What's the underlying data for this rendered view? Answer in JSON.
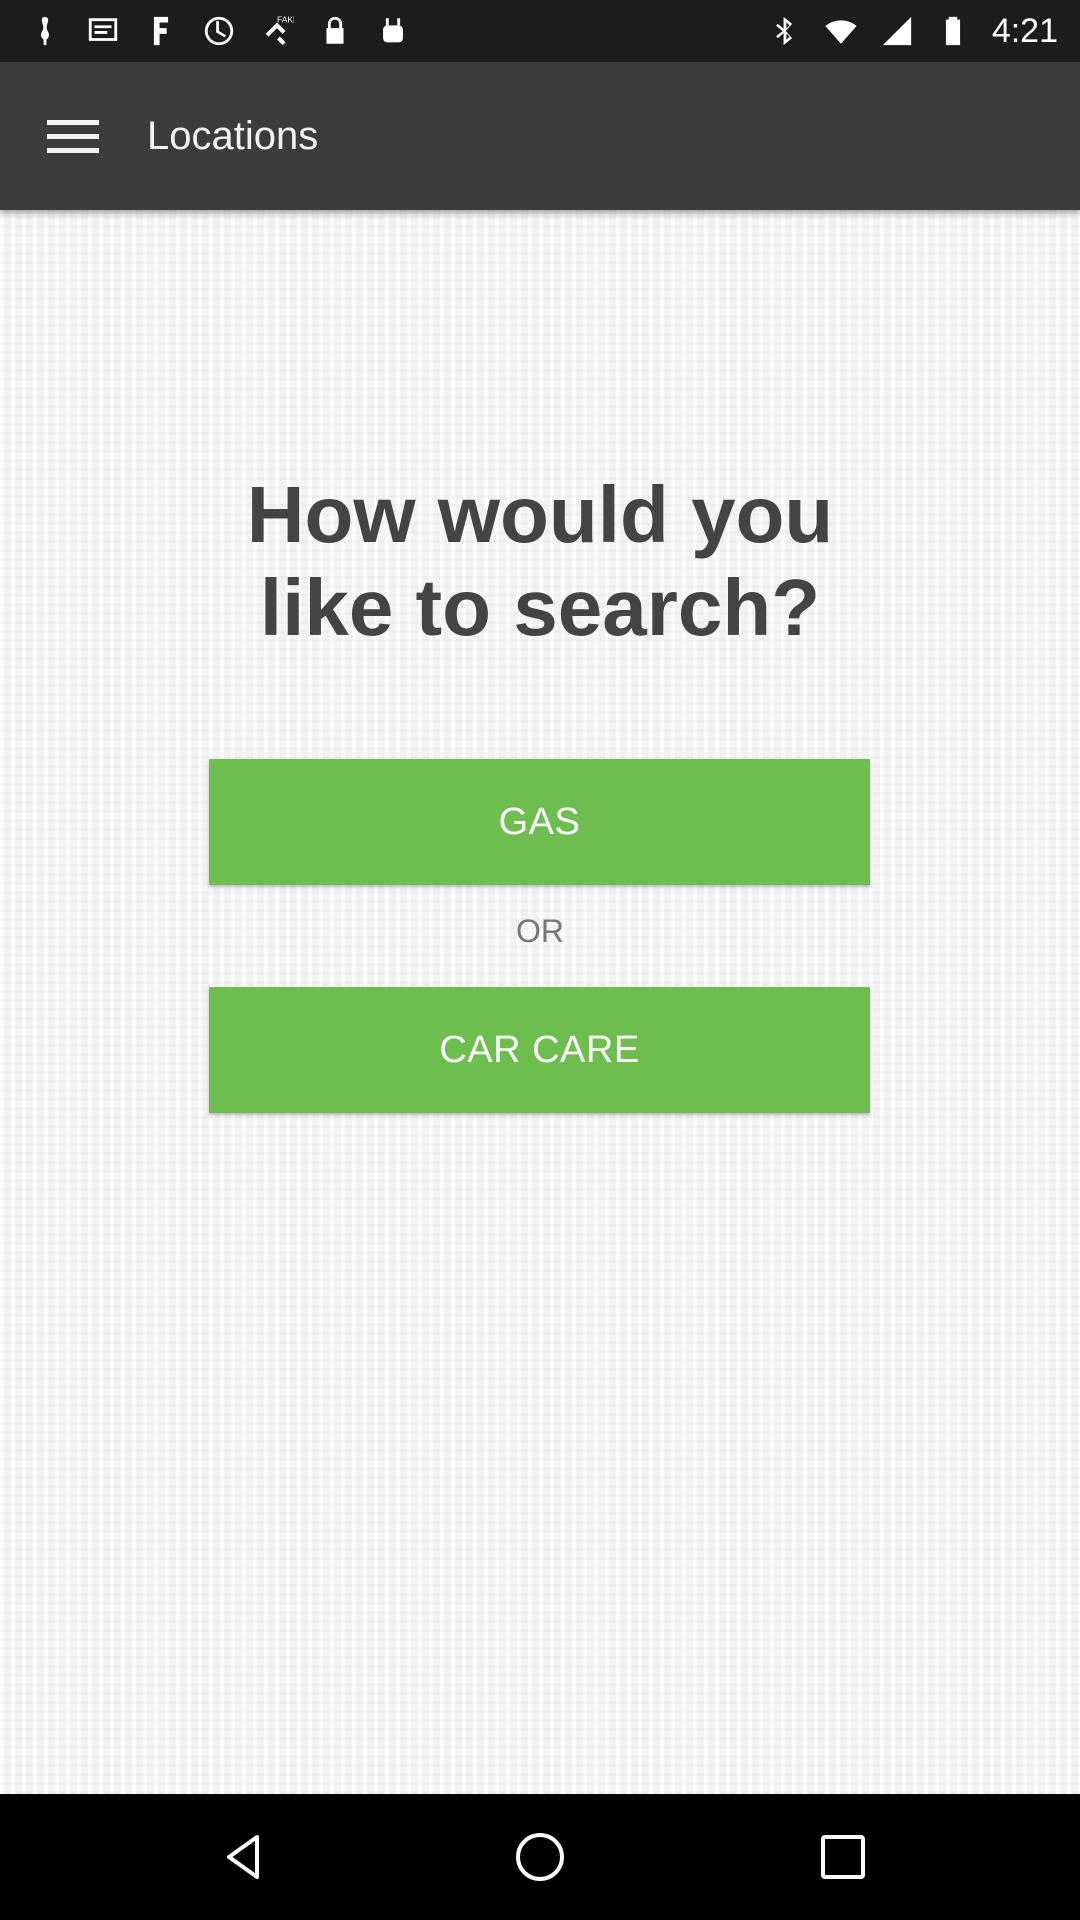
{
  "status_bar": {
    "time": "4:21",
    "left_icons": [
      "notification-icon",
      "message-icon",
      "news-icon",
      "sync-icon",
      "fake-gps-icon",
      "lock-icon",
      "android-icon"
    ],
    "right_icons": [
      "bluetooth-icon",
      "wifi-icon",
      "signal-icon",
      "battery-icon"
    ]
  },
  "app_bar": {
    "title": "Locations",
    "menu_icon": "hamburger-menu-icon",
    "background": "#3c3c3c"
  },
  "main": {
    "question_line1": "How would you",
    "question_line2": "like to search?",
    "gas_label": "GAS",
    "or_label": "OR",
    "car_care_label": "CAR CARE",
    "accent_color": "#6dbe4f"
  },
  "nav_bar": {
    "back_icon": "back-triangle-icon",
    "home_icon": "home-circle-icon",
    "recents_icon": "recents-square-icon"
  }
}
